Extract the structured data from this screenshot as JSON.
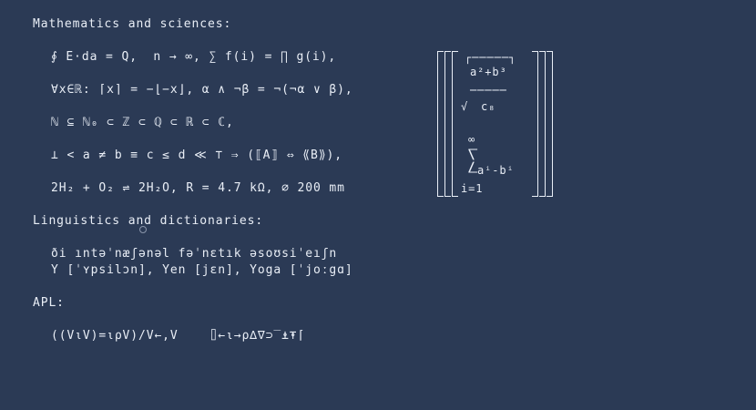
{
  "sections": {
    "math_heading": "Mathematics and sciences:",
    "math_lines": [
      "∮ E⋅da = Q,  n → ∞, ∑ f(i) = ∏ g(i),",
      "∀x∈ℝ: ⌈x⌉ = −⌊−x⌋, α ∧ ¬β = ¬(¬α ∨ β),",
      "ℕ ⊆ ℕ₀ ⊂ ℤ ⊂ ℚ ⊂ ℝ ⊂ ℂ,",
      "⊥ < a ≠ b ≡ c ≤ d ≪ ⊤ ⇒ (⟦A⟧ ⇔ ⟪B⟫),",
      "2H₂ + O₂ ⇌ 2H₂O, R = 4.7 kΩ, ⌀ 200 mm"
    ],
    "ling_heading": "Linguistics and dictionaries:",
    "ling_lines": [
      "ði ıntəˈnæʃənəl fəˈnɛtık əsoʊsiˈeıʃn",
      "Y [ˈʏpsilɔn], Yen [jɛn], Yoga [ˈjoːgɑ]"
    ],
    "apl_heading": "APL:",
    "apl_line": "((V⍳V)=⍳⍴V)/V←,V    ⌷←⍳→⍴∆∇⊃‾⍎⍕⌈"
  },
  "matrix": {
    "top_rule": "┌─────┐",
    "numerator": "a²+b³",
    "divider": "─────",
    "sqrt_sign": "√",
    "denominator": "c₈",
    "sum_top": "∞",
    "sum_sign": "⎲",
    "sum_sign_bottom": "⎳",
    "sum_body": "aⁱ-bⁱ",
    "sum_index": "i=1"
  }
}
